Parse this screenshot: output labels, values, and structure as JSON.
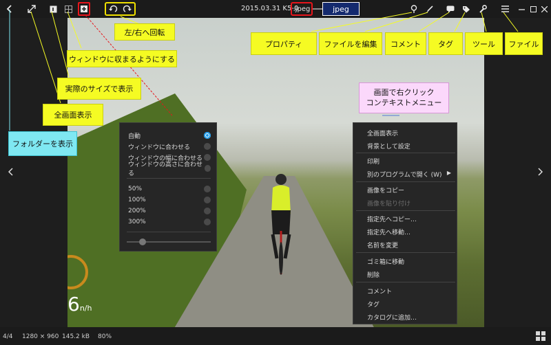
{
  "title": "2015.03.31 K5-0",
  "ext": ".jpeg",
  "jpeg_badge": "jpeg",
  "toolbar": {
    "left_icons": [
      "back-chevron",
      "fullscreen",
      "actual-size",
      "fit-window",
      "toggle-fit",
      "rotate-left",
      "rotate-right"
    ],
    "right_icons": [
      "properties-pin",
      "edit-brush",
      "comment-bubble",
      "tag",
      "wrench",
      "hamburger-menu"
    ]
  },
  "zoom_panel": {
    "options": [
      {
        "label": "自動",
        "selected": true
      },
      {
        "label": "ウィンドウに合わせる",
        "selected": false
      },
      {
        "label": "ウィンドウの幅に合わせる",
        "selected": false
      },
      {
        "label": "ウィンドウの高さに合わせる",
        "selected": false
      }
    ],
    "percents": [
      {
        "label": "50%",
        "selected": false
      },
      {
        "label": "100%",
        "selected": false
      },
      {
        "label": "200%",
        "selected": false
      },
      {
        "label": "300%",
        "selected": false
      }
    ]
  },
  "context_menu": {
    "items": [
      {
        "label": "全画面表示",
        "disabled": false
      },
      {
        "label": "背景として設定",
        "disabled": false
      },
      {
        "label": "印刷",
        "disabled": false
      },
      {
        "label": "別のプログラムで開く (W)",
        "disabled": false,
        "submenu": true
      },
      {
        "label": "画像をコピー",
        "disabled": false
      },
      {
        "label": "画像を貼り付け",
        "disabled": true
      },
      {
        "label": "指定先へコピー…",
        "disabled": false
      },
      {
        "label": "指定先へ移動…",
        "disabled": false
      },
      {
        "label": "名前を変更",
        "disabled": false
      },
      {
        "label": "ゴミ箱に移動",
        "disabled": false
      },
      {
        "label": "削除",
        "disabled": false
      },
      {
        "label": "コメント",
        "disabled": false
      },
      {
        "label": "タグ",
        "disabled": false
      },
      {
        "label": "カタログに追加…",
        "disabled": false
      }
    ]
  },
  "annotations": {
    "rotate": "左/右へ回転",
    "fit": "ウィンドウに収まるようにする",
    "actual": "実際のサイズで表示",
    "fullscreen": "全画面表示",
    "folder": "フォルダーを表示",
    "properties": "プロパティ",
    "edit": "ファイルを編集",
    "comment": "コメント",
    "tag": "タグ",
    "tool": "ツール",
    "file": "ファイル",
    "context_line1": "画面で右クリック",
    "context_line2": "コンテキストメニュー"
  },
  "photo_overlay": {
    "speed": "6",
    "speed_unit": "n/h"
  },
  "status": {
    "index": "4/4",
    "dimensions": "1280 × 960",
    "size": "145.2 kB",
    "zoom": "80%"
  },
  "colors": {
    "annotation_yellow": "#f5fb23",
    "annotation_cyan": "#7fe8f2",
    "annotation_pink": "#fbd8fb",
    "highlight_red": "#e8151b",
    "accent_blue": "#1e9ae8",
    "badge_navy": "#142a6e"
  }
}
